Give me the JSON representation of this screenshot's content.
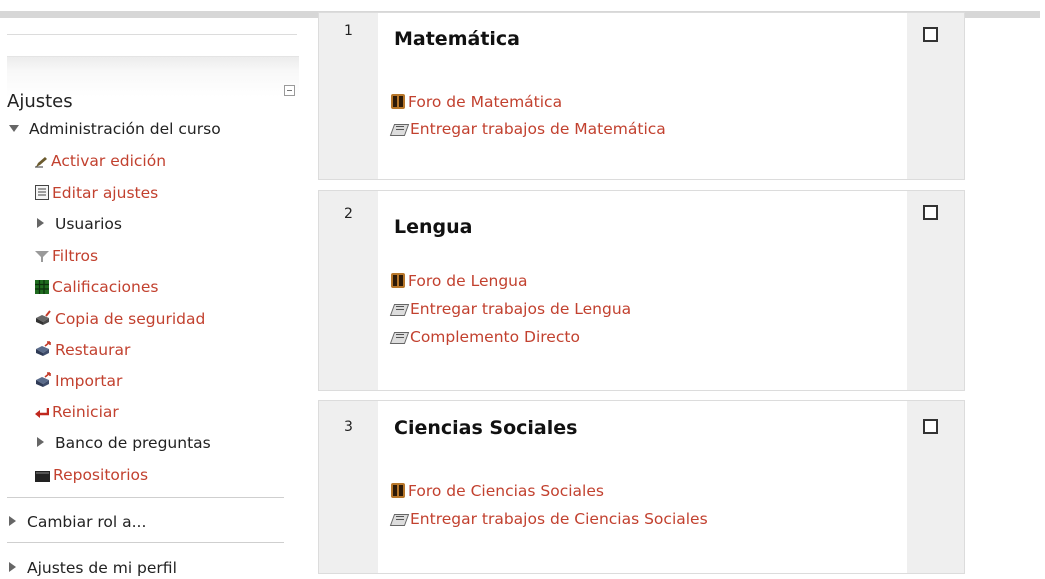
{
  "sidebar": {
    "title": "Ajustes",
    "admin_label": "Administración del curso",
    "items": [
      {
        "label": "Activar edición",
        "icon": "pencil-icon"
      },
      {
        "label": "Editar ajustes",
        "icon": "settings-document-icon"
      },
      {
        "label": "Usuarios",
        "icon": "expand-arrow-icon"
      },
      {
        "label": "Filtros",
        "icon": "filter-icon"
      },
      {
        "label": "Calificaciones",
        "icon": "grades-icon"
      },
      {
        "label": "Copia de seguridad",
        "icon": "backup-icon"
      },
      {
        "label": "Restaurar",
        "icon": "restore-icon"
      },
      {
        "label": "Importar",
        "icon": "import-icon"
      },
      {
        "label": "Reiniciar",
        "icon": "reset-arrow-icon"
      },
      {
        "label": "Banco de preguntas",
        "icon": "expand-arrow-icon"
      },
      {
        "label": "Repositorios",
        "icon": "repository-icon"
      }
    ],
    "switch_role": "Cambiar rol a...",
    "profile_settings": "Ajustes de mi perfil"
  },
  "sections": [
    {
      "number": "1",
      "title": "Matemática",
      "activities": [
        {
          "label": "Foro de Matemática",
          "type": "forum"
        },
        {
          "label": "Entregar trabajos de Matemática",
          "type": "assignment"
        }
      ]
    },
    {
      "number": "2",
      "title": "Lengua",
      "activities": [
        {
          "label": "Foro de Lengua",
          "type": "forum"
        },
        {
          "label": "Entregar trabajos de Lengua",
          "type": "assignment"
        },
        {
          "label": "Complemento Directo",
          "type": "assignment"
        }
      ]
    },
    {
      "number": "3",
      "title": "Ciencias Sociales",
      "activities": [
        {
          "label": "Foro de Ciencias Sociales",
          "type": "forum"
        },
        {
          "label": "Entregar trabajos de Ciencias Sociales",
          "type": "assignment"
        }
      ]
    }
  ],
  "colors": {
    "link": "#c2412f",
    "section_side": "#efefef",
    "border": "#dcdcdc"
  }
}
